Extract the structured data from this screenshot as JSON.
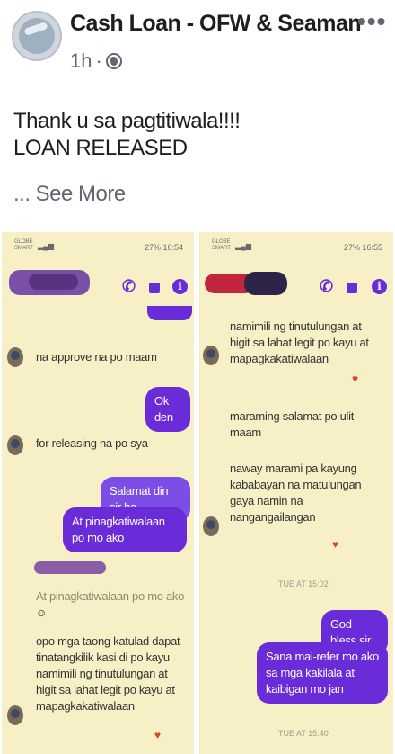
{
  "post": {
    "page_name": "Cash Loan - OFW & Seaman",
    "time": "1h",
    "time_sep": "·",
    "text_line1": "Thank u sa pagtitiwala!!!!",
    "text_line2": "LOAN RELEASED",
    "see_more": "... See More",
    "more_menu": "•••"
  },
  "left_shot": {
    "carrier": "GLOBE\nSMART",
    "status_right": "27% 16:54",
    "messages": {
      "m1": "na approve na po maam",
      "b1": "Ok den",
      "m2": "for releasing na po sya",
      "b2": "Salamat din sir ha",
      "b3": "At pinagkatiwalaan po mo ako",
      "m3": "At pinagkatiwalaan po mo ako",
      "m4": "opo mga taong katulad dapat tinatangkilik kasi di po kayu namimili ng tinutulungan at higit sa lahat legit po kayu at mapagkakatiwalaan"
    }
  },
  "right_shot": {
    "carrier": "GLOBE\nSMART",
    "status_right": "27% 16:55",
    "messages": {
      "m1": "namimili ng tinutulungan at higit sa lahat legit po kayu at mapagkakatiwalaan",
      "m2": "maraming salamat po ulit maam",
      "m3": "naway marami pa kayung kababayan na matulungan gaya namin na nangangailangan",
      "stamp1": "TUE AT 15:02",
      "b1": "God bless sir",
      "b2": "Sana mai-refer mo ako sa mga kakilala at kaibigan mo jan",
      "stamp2": "TUE AT 15:40"
    }
  }
}
